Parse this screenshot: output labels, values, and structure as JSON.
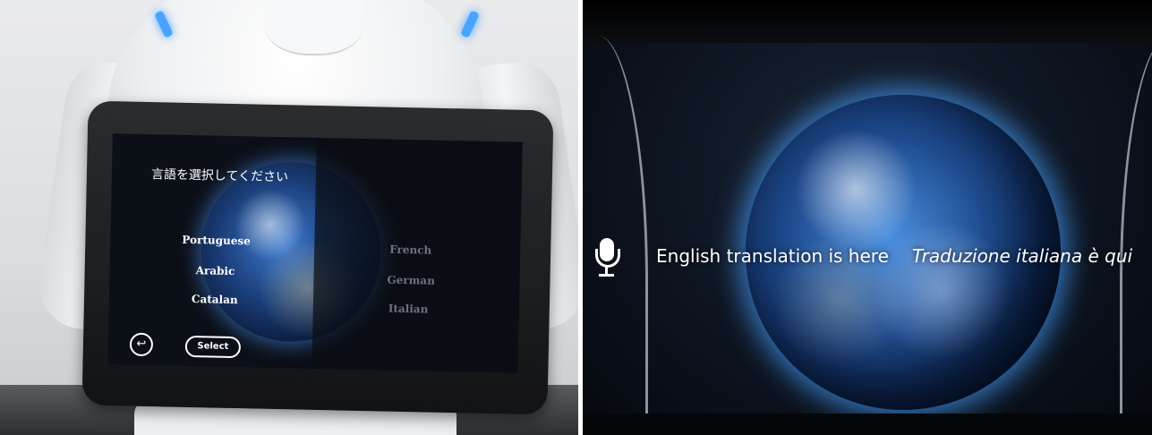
{
  "left_photo": {
    "tablet": {
      "title": "言語を選択してください",
      "languages_left": [
        "Portuguese",
        "Arabic",
        "Catalan"
      ],
      "languages_right": [
        "French",
        "German",
        "Italian"
      ],
      "select_label": "Select",
      "back_icon": "↩"
    }
  },
  "right_photo": {
    "mic_icon": "microphone-icon",
    "caption_english": "English translation is here",
    "caption_italian": "Traduzione italiana è qui"
  },
  "colors": {
    "text": "#ffffff",
    "dim_text": "#6b7280",
    "globe_glow": "#46a0ff"
  }
}
